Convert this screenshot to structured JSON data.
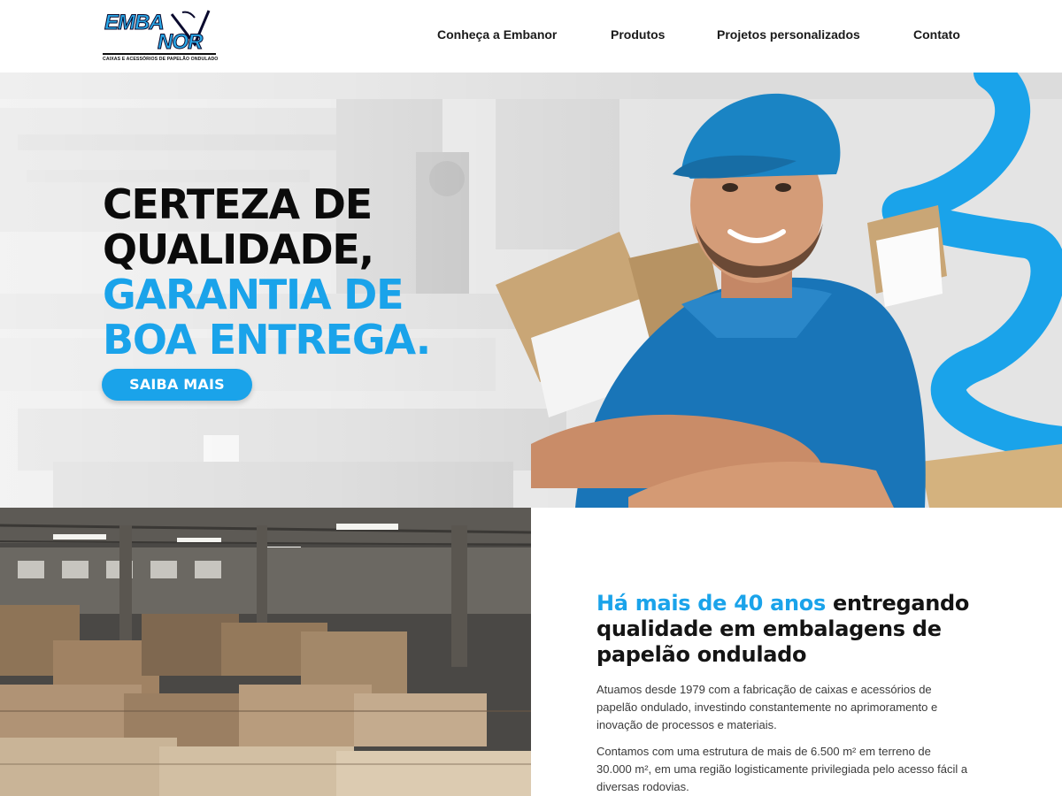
{
  "brand": {
    "logo_top": "EMBA",
    "logo_bottom": "NOR",
    "tagline": "CAIXAS E ACESSÓRIOS DE PAPELÃO ONDULADO",
    "accent_color": "#1aa3ea"
  },
  "nav": {
    "items": [
      {
        "label": "Conheça a Embanor"
      },
      {
        "label": "Produtos"
      },
      {
        "label": "Projetos personalizados"
      },
      {
        "label": "Contato"
      }
    ]
  },
  "hero": {
    "line1": "CERTEZA DE",
    "line2": "QUALIDADE,",
    "line3": "GARANTIA DE",
    "line4": "BOA ENTREGA.",
    "cta_label": "SAIBA MAIS"
  },
  "about": {
    "title_accent": "Há mais de 40 anos",
    "title_rest": " entregando qualidade em embalagens de papelão ondulado",
    "paragraph1": "Atuamos desde 1979 com a fabricação de caixas e acessórios de papelão ondulado, investindo constantemente no aprimoramento e inovação de processos e materiais.",
    "paragraph2": "Contamos com uma estrutura de mais de 6.500 m² em terreno de 30.000 m², em uma região logisticamente privilegiada pelo acesso fácil a diversas rodovias."
  }
}
